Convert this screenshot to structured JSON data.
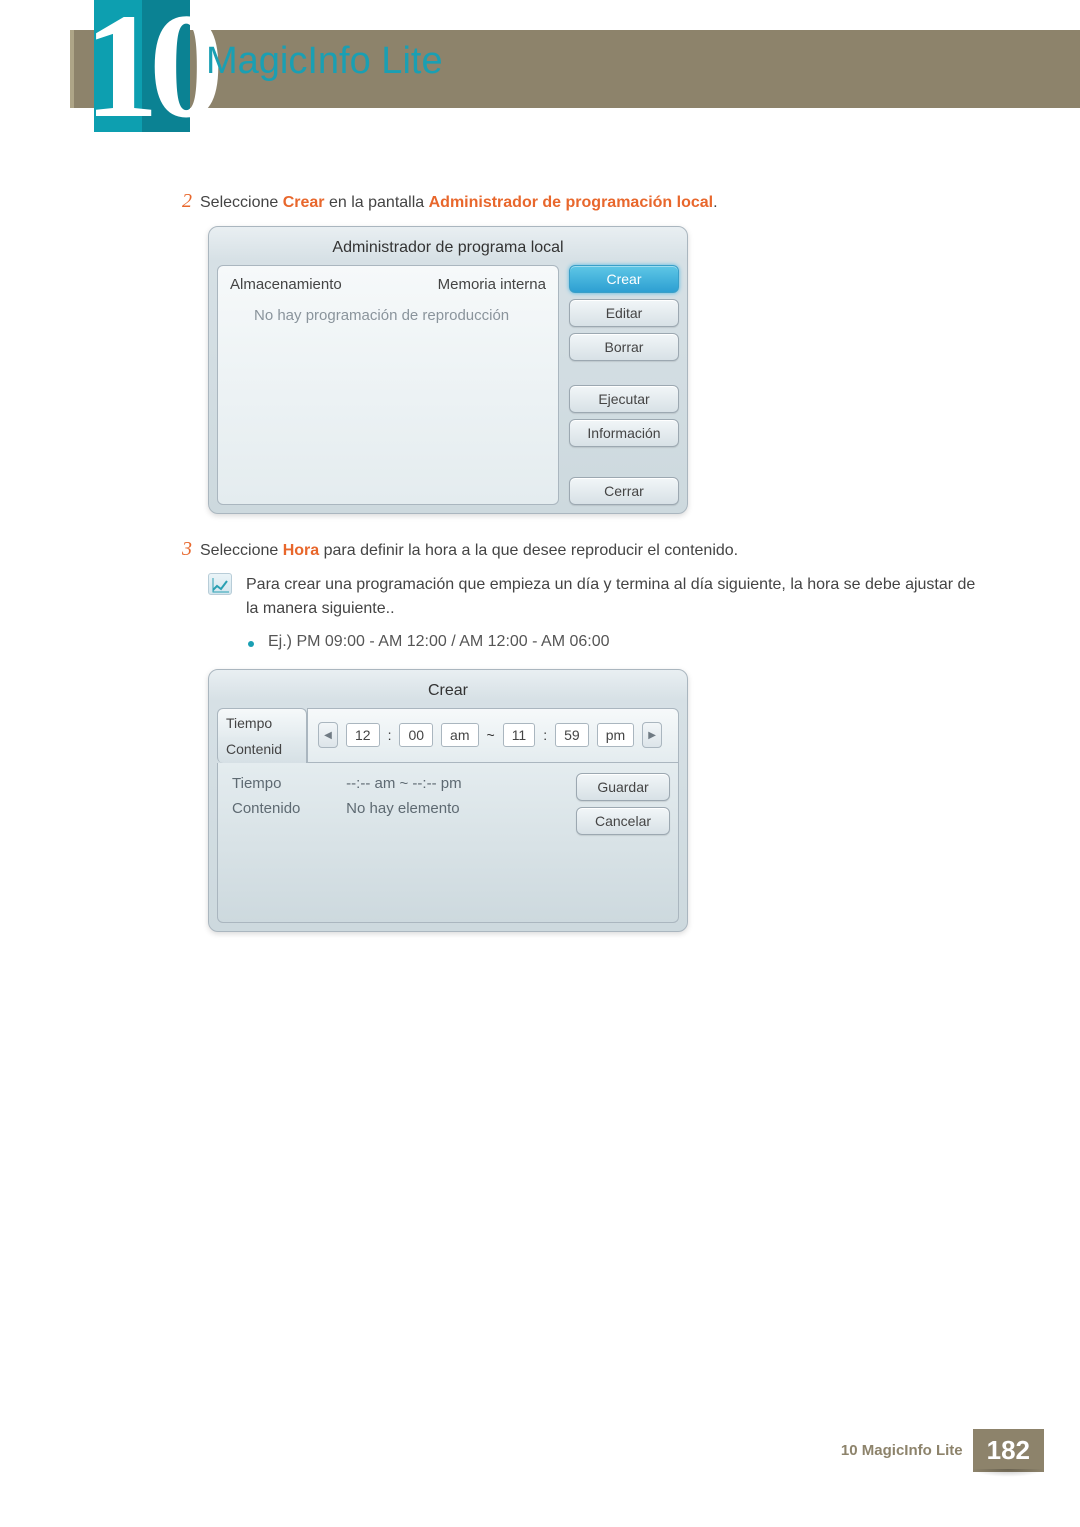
{
  "chapter": {
    "number": "10",
    "title": "MagicInfo Lite"
  },
  "step2": {
    "num": "2",
    "prefix": "Seleccione ",
    "hl1": "Crear",
    "mid": " en la pantalla ",
    "hl2": "Administrador de programación local",
    "suffix": "."
  },
  "panel1": {
    "title": "Administrador de programa local",
    "storage_label": "Almacenamiento",
    "storage_value": "Memoria interna",
    "empty_msg": "No hay programación de reproducción",
    "buttons": {
      "create": "Crear",
      "edit": "Editar",
      "delete": "Borrar",
      "run": "Ejecutar",
      "info": "Información",
      "close": "Cerrar"
    }
  },
  "step3": {
    "num": "3",
    "prefix": "Seleccione ",
    "hl1": "Hora",
    "suffix": " para definir la hora a la que desee reproducir el contenido."
  },
  "note": {
    "line1": "Para crear una programación que empieza un día y termina al día siguiente, la hora se debe ajustar de la manera siguiente.."
  },
  "example": {
    "text": "Ej.) PM 09:00 - AM 12:00 / AM 12:00 - AM 06:00"
  },
  "panel2": {
    "title": "Crear",
    "tab_time": "Tiempo",
    "tab_content": "Contenid",
    "time": {
      "h1": "12",
      "m1": "00",
      "ampm1": "am",
      "tilde": "~",
      "h2": "11",
      "m2": "59",
      "ampm2": "pm"
    },
    "row_time_label": "Tiempo",
    "row_time_value": "--:-- am ~ --:-- pm",
    "row_content_label": "Contenido",
    "row_content_value": "No hay elemento",
    "buttons": {
      "save": "Guardar",
      "cancel": "Cancelar"
    }
  },
  "footer": {
    "text": "10 MagicInfo Lite",
    "page": "182"
  }
}
